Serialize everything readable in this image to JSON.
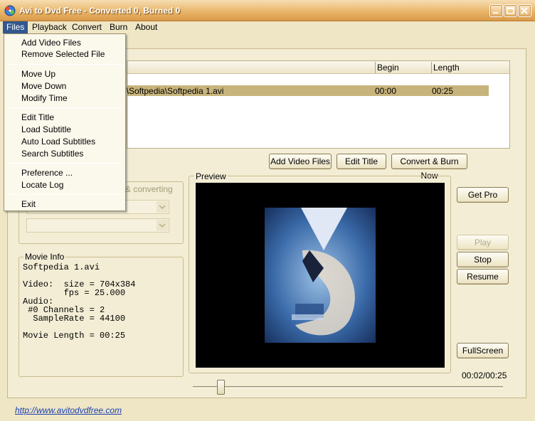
{
  "window": {
    "title": "Avi to Dvd Free - Converted 0, Burned 0"
  },
  "menubar": {
    "files": "Files",
    "playback": "Playback",
    "convert": "Convert",
    "burn": "Burn",
    "about": "About"
  },
  "files_menu": {
    "items": [
      "Add Video Files",
      "Remove Selected File",
      "Move Up",
      "Move Down",
      "Modify Time",
      "Edit Title",
      "Load Subtitle",
      "Auto Load Subtitles",
      "Search Subtitles",
      "Preference ...",
      "Locate Log",
      "Exit"
    ]
  },
  "file_list": {
    "columns": [
      "Begin",
      "Length"
    ],
    "rows": [
      {
        "name": "p\\Softpedia\\Softpedia 1.avi",
        "begin": "00:00",
        "length": "00:25"
      }
    ]
  },
  "actions": {
    "add_video_files": "Add Video Files",
    "edit_title": "Edit Title",
    "convert_burn_now": "Convert & Burn Now"
  },
  "options_group": {
    "label_fragment": "& converting"
  },
  "movie_info": {
    "label": "Movie Info",
    "text": "Softpedia 1.avi\n\nVideo:  size = 704x384\n        fps = 25.000\nAudio:\n #0 Channels = 2\n  SampleRate = 44100\n\nMovie Length = 00:25"
  },
  "preview": {
    "label": "Preview",
    "time": "00:02/00:25",
    "position": 0.08
  },
  "side_buttons": {
    "get_pro": "Get Pro",
    "play": "Play",
    "stop": "Stop",
    "resume": "Resume",
    "fullscreen": "FullScreen"
  },
  "statusbar": {
    "url": "http://www.avitodvdfree.com"
  },
  "colors": {
    "menu_highlight": "#32578e",
    "selected_row": "#c7b47c",
    "background": "#efe6c6"
  }
}
